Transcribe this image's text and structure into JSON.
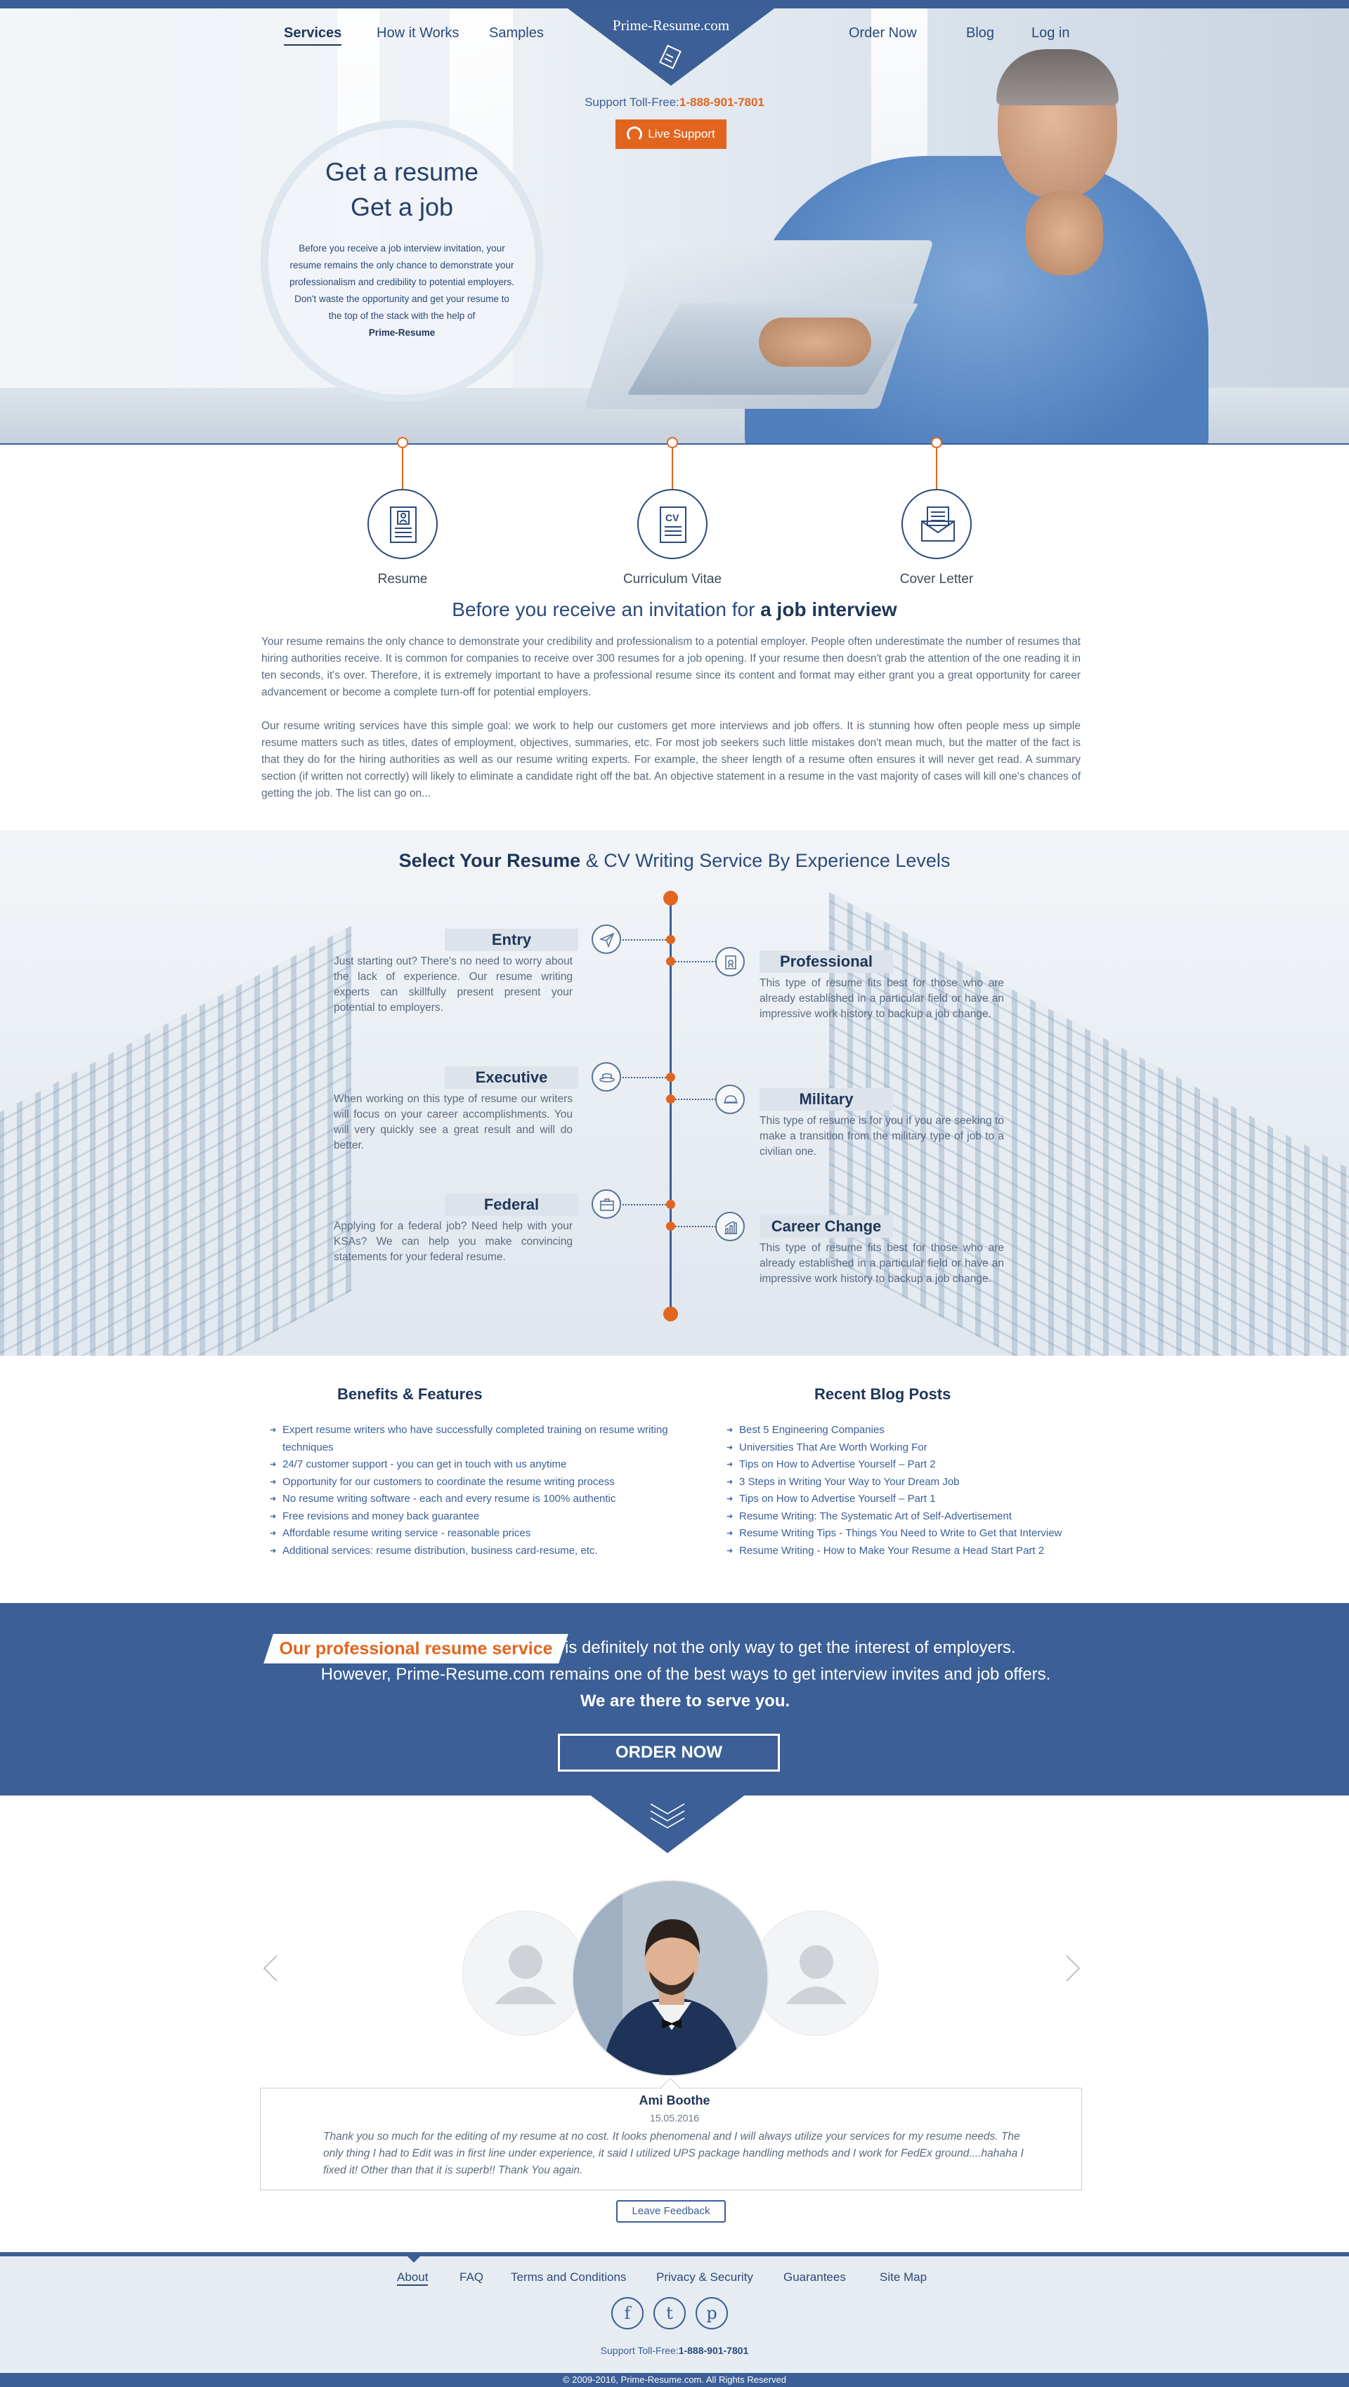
{
  "nav": {
    "left": [
      "Services",
      "How it Works",
      "Samples"
    ],
    "right": [
      "Order Now",
      "Blog",
      "Log in"
    ]
  },
  "logo": "Prime-Resume.com",
  "support": {
    "label": "Support Toll-Free:",
    "phone": "1-888-901-7801"
  },
  "live_support": "Live Support",
  "hero": {
    "line1": "Get a resume",
    "line2": "Get a job",
    "text": "Before you receive a job interview invitation, your resume remains the only chance to demonstrate your professionalism and credibility to potential employers. Don't waste the opportunity and get your resume to the top of the stack with the help of",
    "brand": "Prime-Resume"
  },
  "services": [
    "Resume",
    "Curriculum Vitae",
    "Cover Letter"
  ],
  "intro": {
    "title_plain": "Before you receive an invitation for",
    "title_bold": "a job interview",
    "p1": "Your resume remains the only chance to demonstrate your credibility and professionalism to a potential employer. People often underestimate the number of resumes that hiring authorities receive. It is common for companies to receive over 300 resumes for a job opening. If your resume then doesn't grab the attention of the one reading it in ten seconds, it's over. Therefore, it is extremely important to have a professional resume since its content and format may either grant you a great opportunity for career advancement or become a complete turn-off for potential employers.",
    "p2": "Our resume writing services have this simple goal: we work to help our customers get more interviews and job offers. It is stunning how often people mess up simple resume matters such as titles, dates of employment, objectives, summaries, etc. For most job seekers such little mistakes don't mean much, but the matter of the fact is that they do for the hiring authorities as well as our resume writing experts. For example, the sheer length of a resume often ensures it will never get read. A summary section (if written not correctly) will likely to eliminate a candidate right off the bat. An objective statement in a resume in the vast majority of cases will kill one's chances of getting the job. The list can go on..."
  },
  "levels": {
    "title_bold": "Select Your Resume",
    "title_plain": "& CV Writing Service By Experience Levels",
    "items": [
      {
        "name": "Entry",
        "text": "Just starting out? There's no need to worry about the lack of experience. Our resume writing experts can skillfully present present your potential to employers."
      },
      {
        "name": "Professional",
        "text": "This type of resume fits best for those who are already established in a particular field or have an impressive work history to backup a job change."
      },
      {
        "name": "Executive",
        "text": "When working on this type of resume our writers will focus on your career accomplishments. You will very quickly see a great result and will do better."
      },
      {
        "name": "Military",
        "text": "This type of resume is for you if you are seeking to make a transition from the military type of job to a civilian one."
      },
      {
        "name": "Federal",
        "text": "Applying for a federal job? Need help with your KSAs? We can help you make convincing statements for your federal resume."
      },
      {
        "name": "Career Change",
        "text": "This type of resume fits best for those who are already established in a particular field or have an impressive work history to backup a job change."
      }
    ]
  },
  "benefits": {
    "title": "Benefits & Features",
    "items": [
      "Expert resume writers who have successfully completed training on resume writing techniques",
      "24/7 customer support - you can get in touch with us anytime",
      "Opportunity for our customers to coordinate the resume writing process",
      "No resume writing software - each and every resume is 100% authentic",
      "Free revisions and money back guarantee",
      "Affordable resume writing service - reasonable prices",
      "Additional services: resume distribution, business card-resume, etc."
    ]
  },
  "blog": {
    "title": "Recent Blog Posts",
    "items": [
      "Best 5 Engineering Companies",
      "Universities That Are Worth Working For",
      "Tips on How to Advertise Yourself – Part 2",
      "3 Steps in Writing Your Way to Your Dream Job",
      "Tips on How to Advertise Yourself – Part 1",
      "Resume Writing: The Systematic Art of Self-Advertisement",
      "Resume Writing Tips - Things You Need to Write to Get that Interview",
      "Resume Writing - How to Make Your Resume a Head Start Part 2"
    ]
  },
  "banner": {
    "tag": "Our professional resume service",
    "line1": "is definitely not the only way to get the interest of employers.",
    "line2": "However, Prime-Resume.com remains one of the best ways to get interview invites and job offers.",
    "line3": "We are there to serve you.",
    "button": "ORDER NOW"
  },
  "testimonial": {
    "name": "Ami Boothe",
    "date": "15.05.2016",
    "text": "Thank you so much for the editing of my resume at no cost. It looks phenomenal and I will always utilize your services for my resume needs. The only thing I had to Edit was in first line under experience, it said I utilized UPS package handling methods and I work for FedEx ground....hahaha I fixed it! Other than that it is superb!! Thank You again.",
    "button": "Leave Feedback"
  },
  "footer": {
    "links": [
      "About",
      "FAQ",
      "Terms and Conditions",
      "Privacy & Security",
      "Guarantees",
      "Site Map"
    ],
    "social": [
      "f",
      "t",
      "p"
    ],
    "support_label": "Support Toll-Free:",
    "support_phone": "1-888-901-7801",
    "copyright": "© 2009-2016, Prime-Resume.com. All Rights Reserved"
  },
  "colors": {
    "navy": "#3b5f96",
    "orange": "#e2651f",
    "dark": "#1f3659"
  }
}
